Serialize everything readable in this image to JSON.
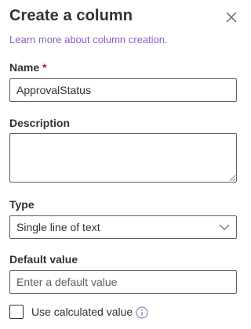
{
  "panel": {
    "title": "Create a column",
    "learn_more": "Learn more about column creation."
  },
  "name": {
    "label": "Name",
    "required_mark": "*",
    "value": "ApprovalStatus"
  },
  "description": {
    "label": "Description",
    "value": ""
  },
  "type": {
    "label": "Type",
    "selected": "Single line of text"
  },
  "default_value": {
    "label": "Default value",
    "placeholder": "Enter a default value",
    "value": ""
  },
  "calculated": {
    "label": "Use calculated value",
    "checked": false
  },
  "icons": {
    "close": "close-icon",
    "chevron": "chevron-down-icon",
    "info": "info-icon",
    "link_color": "#8764b8"
  }
}
